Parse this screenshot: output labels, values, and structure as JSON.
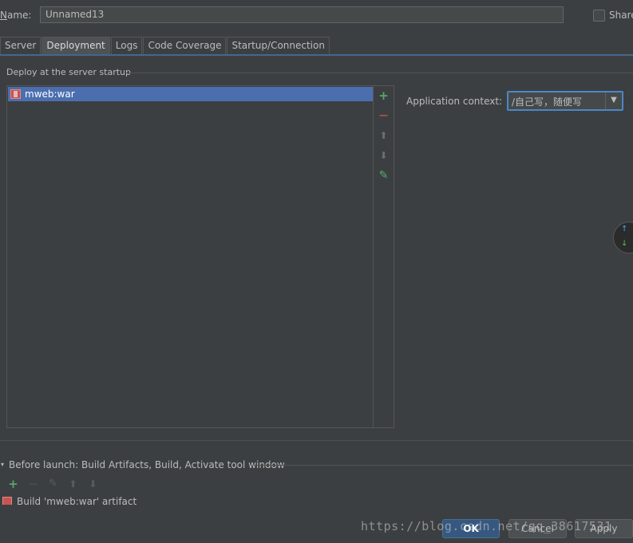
{
  "name_row": {
    "label": "Name:",
    "label_underlined_char": "N",
    "label_rest": "ame:",
    "value": "Unnamed13",
    "share_label": "Share"
  },
  "tabs": [
    {
      "label": "Server",
      "active": false
    },
    {
      "label": "Deployment",
      "active": true
    },
    {
      "label": "Logs",
      "active": false
    },
    {
      "label": "Code Coverage",
      "active": false
    },
    {
      "label": "Startup/Connection",
      "active": false
    }
  ],
  "deploy": {
    "section_title": "Deploy at the server startup",
    "items": [
      {
        "label": "mweb:war",
        "selected": true
      }
    ],
    "toolbar": {
      "add": "+",
      "remove": "—",
      "up": "⬆",
      "down": "⬇",
      "edit": "✎"
    }
  },
  "context": {
    "label": "Application context:",
    "value": "/自己写，随便写",
    "arrow": "▼"
  },
  "float_widget": {
    "up": "↑",
    "down": "↓"
  },
  "before_launch": {
    "title": "Before launch: Build Artifacts, Build, Activate tool window",
    "toggle": "▾",
    "toolbar": {
      "add": "+",
      "remove": "—",
      "edit": "✎",
      "up": "⬆",
      "down": "⬇"
    },
    "items": [
      {
        "label": "Build 'mweb:war' artifact"
      }
    ]
  },
  "buttons": {
    "ok": "OK",
    "cancel": "Cancel",
    "apply": "Apply"
  },
  "watermark": "https://blog.csdn.net/qq_38617531",
  "colors": {
    "background": "#3c3f41",
    "selection": "#4b6eaf",
    "accent": "#4a88c7",
    "add_green": "#59a869",
    "remove_red": "#c75450"
  }
}
